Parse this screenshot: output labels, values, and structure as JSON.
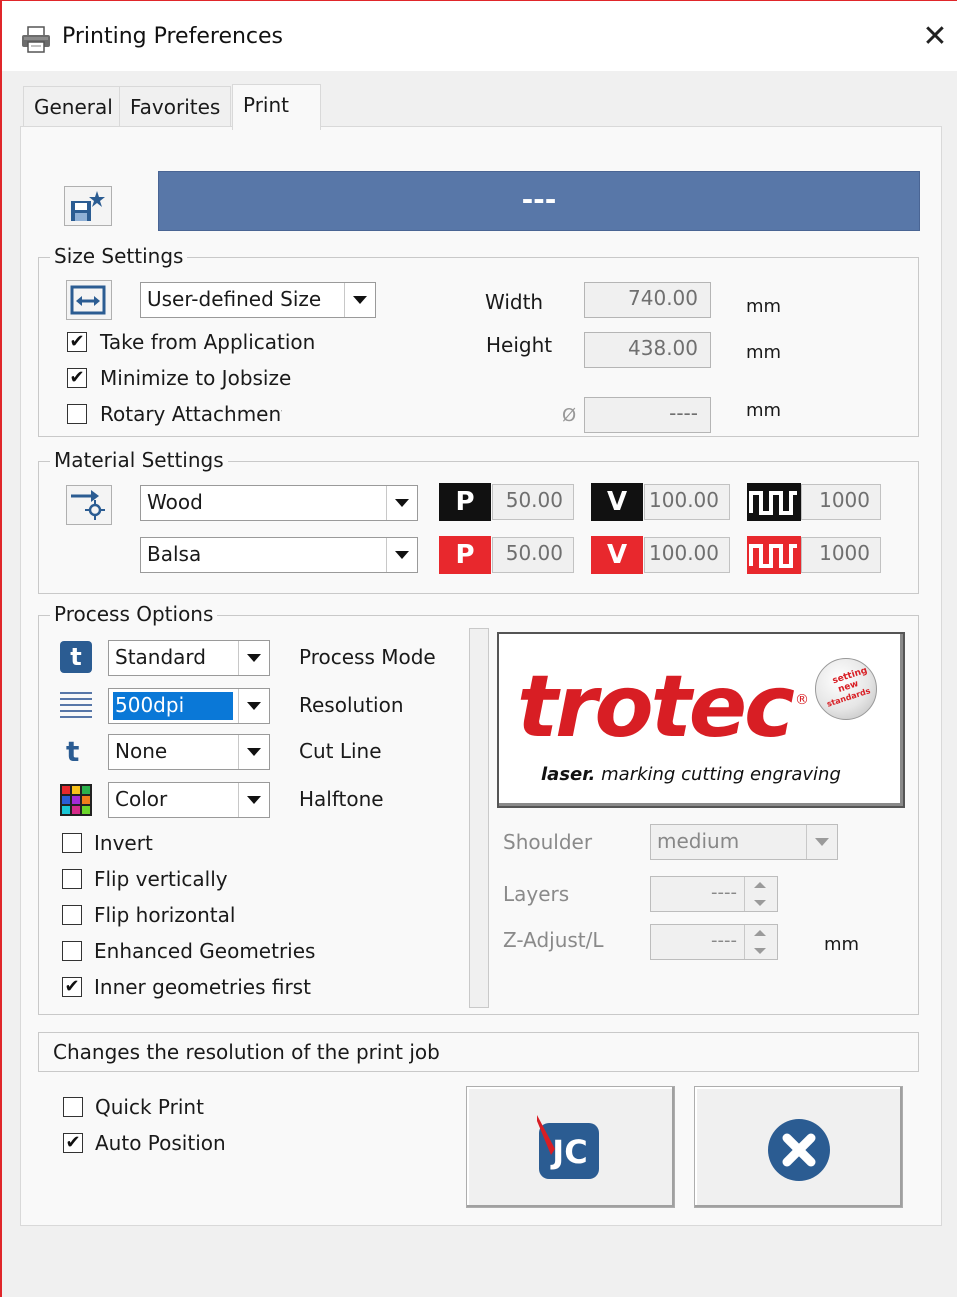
{
  "window": {
    "title": "Printing Preferences",
    "close_glyph": "✕"
  },
  "tabs": [
    {
      "label": "General"
    },
    {
      "label": "Favorites"
    },
    {
      "label": "Print"
    }
  ],
  "banner": {
    "text": "---"
  },
  "size_settings": {
    "group_label": "Size Settings",
    "size_combo": "User-defined Size",
    "width_label": "Width",
    "width_value": "740.00",
    "height_label": "Height",
    "height_value": "438.00",
    "diameter_symbol": "Ø",
    "diameter_value": "----",
    "unit": "mm",
    "checkboxes": [
      {
        "label": "Take from Application",
        "checked": true
      },
      {
        "label": "Minimize to Jobsize",
        "checked": true
      },
      {
        "label": "Rotary Attachment",
        "checked": false
      }
    ]
  },
  "material_settings": {
    "group_label": "Material Settings",
    "material": "Wood",
    "submaterial": "Balsa",
    "row1": {
      "power": "50.00",
      "velocity": "100.00",
      "frequency": "1000"
    },
    "row2": {
      "power": "50.00",
      "velocity": "100.00",
      "frequency": "1000"
    },
    "power_letter": "P",
    "velocity_letter": "V",
    "colors": {
      "engrave": "#111111",
      "cut": "#e8282d"
    }
  },
  "process_options": {
    "group_label": "Process Options",
    "rows": [
      {
        "value": "Standard",
        "label": "Process Mode"
      },
      {
        "value": "500dpi",
        "label": "Resolution"
      },
      {
        "value": "None",
        "label": "Cut Line"
      },
      {
        "value": "Color",
        "label": "Halftone"
      }
    ],
    "checkboxes": [
      {
        "label": "Invert",
        "checked": false
      },
      {
        "label": "Flip vertically",
        "checked": false
      },
      {
        "label": "Flip horizontal",
        "checked": false
      },
      {
        "label": "Enhanced Geometries",
        "checked": false
      },
      {
        "label": "Inner geometries first",
        "checked": true
      }
    ],
    "logo": {
      "brand": "trotec",
      "tagline_bold": "laser.",
      "tagline": "marking cutting engraving",
      "seal": [
        "setting",
        "new",
        "standards"
      ]
    },
    "shoulder_label": "Shoulder",
    "shoulder_value": "medium",
    "layers_label": "Layers",
    "layers_value": "----",
    "zadjust_label": "Z-Adjust/L",
    "zadjust_value": "----",
    "zadjust_unit": "mm"
  },
  "status": {
    "text": "Changes the resolution of the print job"
  },
  "footer": {
    "checkboxes": [
      {
        "label": "Quick Print",
        "checked": false
      },
      {
        "label": "Auto Position",
        "checked": true
      }
    ],
    "job_button_text": "JC"
  }
}
